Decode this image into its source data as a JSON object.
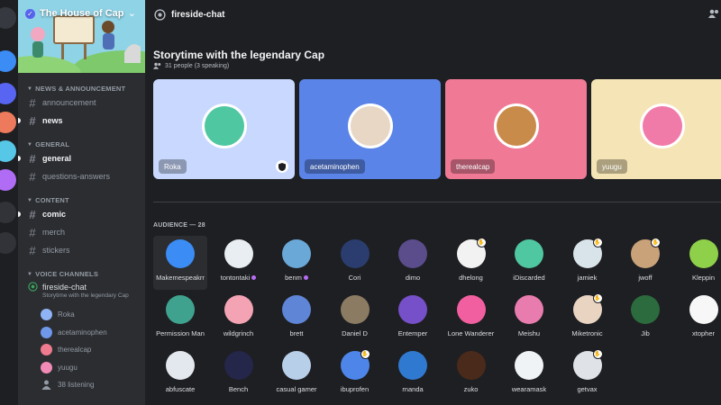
{
  "server": {
    "name": "The House of Cap",
    "rail_colors": [
      "#3b8cf4",
      "#5865f2",
      "#ed7a5c",
      "#57c7e8",
      "#b16cf5"
    ]
  },
  "sidebar": {
    "categories": [
      {
        "label": "NEWS & ANNOUNCEMENT",
        "channels": [
          {
            "name": "announcement",
            "unread": false
          },
          {
            "name": "news",
            "unread": true
          }
        ]
      },
      {
        "label": "GENERAL",
        "channels": [
          {
            "name": "general",
            "unread": true
          },
          {
            "name": "questions-answers",
            "unread": false
          }
        ]
      },
      {
        "label": "CONTENT",
        "channels": [
          {
            "name": "comic",
            "unread": true
          },
          {
            "name": "merch",
            "unread": false
          },
          {
            "name": "stickers",
            "unread": false
          }
        ]
      }
    ],
    "voice_category": "VOICE CHANNELS",
    "voice_channel": {
      "name": "fireside-chat",
      "topic": "Storytime with the legendary Cap",
      "users": [
        "Roka",
        "acetaminophen",
        "therealcap",
        "yuugu"
      ],
      "listening": "38 listening"
    }
  },
  "header": {
    "channel": "fireside-chat"
  },
  "stage": {
    "title": "Storytime with the legendary Cap",
    "subtitle": "31 people (3 speaking)",
    "speakers": [
      {
        "name": "Roka",
        "bg": "#c9d8ff",
        "moderator": true
      },
      {
        "name": "acetaminophen",
        "bg": "#5b84e8",
        "moderator": false
      },
      {
        "name": "therealcap",
        "bg": "#f07a95",
        "moderator": false
      },
      {
        "name": "yuugu",
        "bg": "#f5e4b5",
        "moderator": false
      }
    ]
  },
  "audience": {
    "header": "AUDIENCE — 28",
    "members": [
      {
        "name": "Makemespeakrr",
        "color": "#3b8cf4",
        "badge": false,
        "nitro": false
      },
      {
        "name": "tontontaki",
        "color": "#e9eef2",
        "badge": false,
        "nitro": true
      },
      {
        "name": "benm",
        "color": "#6aa8d8",
        "badge": false,
        "nitro": true
      },
      {
        "name": "Cori",
        "color": "#2a3d6e",
        "badge": false,
        "nitro": false
      },
      {
        "name": "dimo",
        "color": "#5b4c8c",
        "badge": false,
        "nitro": false
      },
      {
        "name": "dhelong",
        "color": "#f2f2f2",
        "badge": true,
        "nitro": false
      },
      {
        "name": "iDiscarded",
        "color": "#4fc7a0",
        "badge": false,
        "nitro": false
      },
      {
        "name": "jamiek",
        "color": "#d9e4ea",
        "badge": true,
        "nitro": false
      },
      {
        "name": "jwoff",
        "color": "#c9a27a",
        "badge": true,
        "nitro": false
      },
      {
        "name": "Kleppin",
        "color": "#8fd04a",
        "badge": false,
        "nitro": false
      },
      {
        "name": "Permission Man",
        "color": "#3fa28e",
        "badge": false,
        "nitro": false
      },
      {
        "name": "wildgrinch",
        "color": "#f4a3b4",
        "badge": false,
        "nitro": false
      },
      {
        "name": "brett",
        "color": "#5e85d6",
        "badge": false,
        "nitro": false
      },
      {
        "name": "Daniel D",
        "color": "#8c7b63",
        "badge": false,
        "nitro": false
      },
      {
        "name": "Entemper",
        "color": "#7650c8",
        "badge": false,
        "nitro": false
      },
      {
        "name": "Lone Wanderer",
        "color": "#f25fa0",
        "badge": false,
        "nitro": false
      },
      {
        "name": "Meishu",
        "color": "#e87cae",
        "badge": false,
        "nitro": false
      },
      {
        "name": "Miketronic",
        "color": "#e9d4c2",
        "badge": true,
        "nitro": false
      },
      {
        "name": "Jib",
        "color": "#2b6b3d",
        "badge": false,
        "nitro": false
      },
      {
        "name": "xtopher",
        "color": "#f7f7f7",
        "badge": false,
        "nitro": false
      },
      {
        "name": "abfuscate",
        "color": "#e3e8ee",
        "badge": false,
        "nitro": false
      },
      {
        "name": "Bench",
        "color": "#24264a",
        "badge": false,
        "nitro": false
      },
      {
        "name": "casual gamer",
        "color": "#b8cfea",
        "badge": false,
        "nitro": false
      },
      {
        "name": "ibuprofen",
        "color": "#4d86e8",
        "badge": true,
        "nitro": false
      },
      {
        "name": "rnanda",
        "color": "#2f7ad0",
        "badge": false,
        "nitro": false
      },
      {
        "name": "zuko",
        "color": "#4a2a1a",
        "badge": false,
        "nitro": false
      },
      {
        "name": "wearamask",
        "color": "#f0f3f5",
        "badge": false,
        "nitro": false
      },
      {
        "name": "getvax",
        "color": "#dfe3e7",
        "badge": true,
        "nitro": false
      }
    ]
  }
}
